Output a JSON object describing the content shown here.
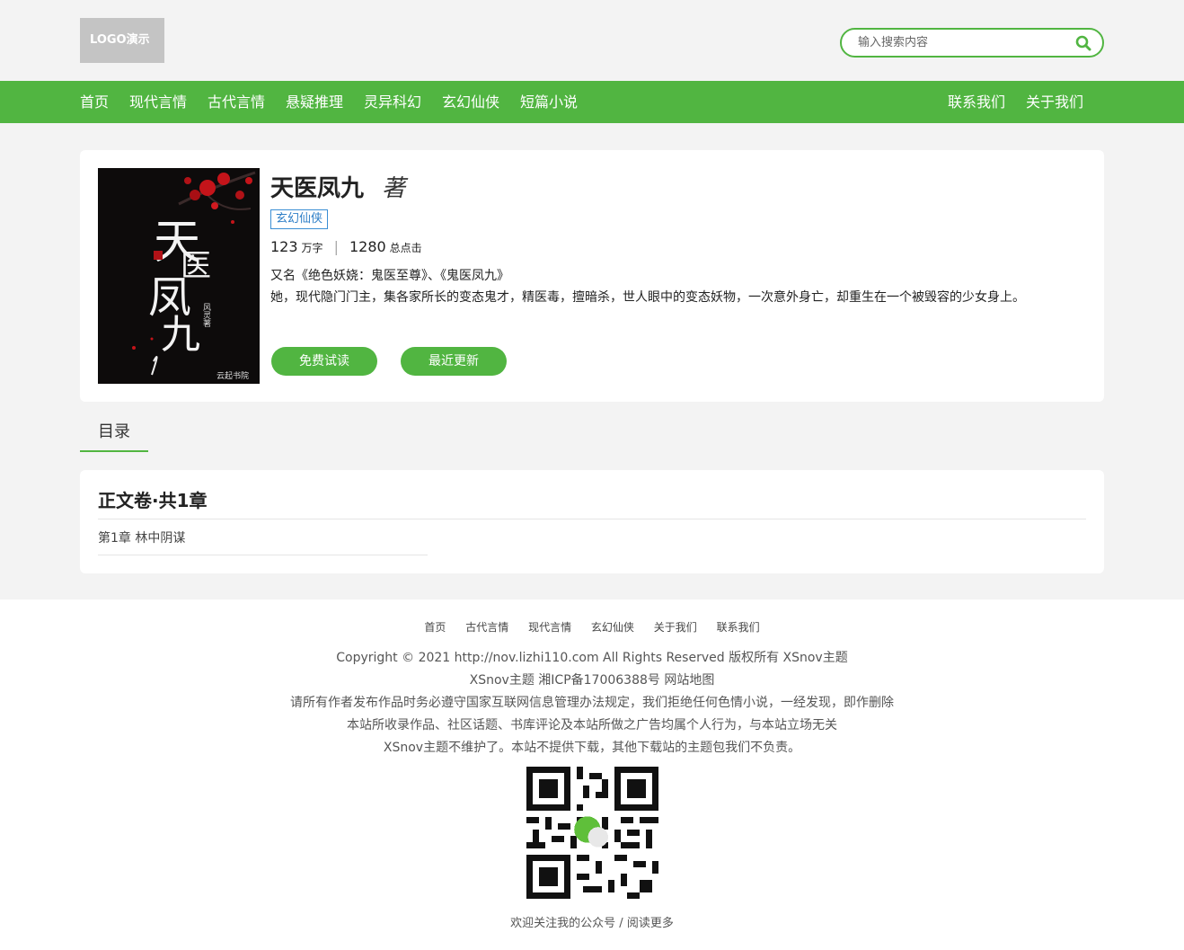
{
  "header": {
    "logo_text": "LOGO演示",
    "search_placeholder": "输入搜索内容"
  },
  "nav": {
    "left": [
      "首页",
      "现代言情",
      "古代言情",
      "悬疑推理",
      "灵异科幻",
      "玄幻仙侠",
      "短篇小说"
    ],
    "right": [
      "联系我们",
      "关于我们"
    ]
  },
  "book": {
    "title": "天医凤九",
    "author_suffix": "著",
    "category": "玄幻仙侠",
    "word_count": "123",
    "word_unit": "万字",
    "clicks": "1280",
    "clicks_unit": "总点击",
    "alias": "又名《绝色妖娆：鬼医至尊》、《鬼医凤九》",
    "description": "她，现代隐门门主，集各家所长的变态鬼才，精医毒，擅暗杀，世人眼中的变态妖物，一次意外身亡，却重生在一个被毁容的少女身上。",
    "buttons": {
      "free_read": "免费试读",
      "latest_update": "最近更新"
    },
    "cover": {
      "title_chars": [
        "天",
        "医",
        "凤",
        "九"
      ],
      "author_seal": "风灵著",
      "publisher": "云起书院"
    }
  },
  "toc": {
    "tab_label": "目录",
    "volume_title": "正文卷·共1章",
    "chapters": [
      "第1章 林中阴谋"
    ]
  },
  "footer": {
    "nav": [
      "首页",
      "古代言情",
      "现代言情",
      "玄幻仙侠",
      "关于我们",
      "联系我们"
    ],
    "copyright": "Copyright © 2021 http://nov.lizhi110.com All Rights Reserved 版权所有 XSnov主题",
    "icp": "XSnov主题 湘ICP备17006388号 网站地图",
    "notice1": "请所有作者发布作品时务必遵守国家互联网信息管理办法规定，我们拒绝任何色情小说，一经发现，即作删除",
    "notice2": "本站所收录作品、社区话题、书库评论及本站所做之广告均属个人行为，与本站立场无关",
    "notice3": "XSnov主题不维护了。本站不提供下载，其他下载站的主题包我们不负责。",
    "qr_caption": "欢迎关注我的公众号 / 阅读更多"
  },
  "colors": {
    "brand_green": "#51b541",
    "tag_blue": "#2d7ec7",
    "page_bg": "#f3f3f3"
  }
}
